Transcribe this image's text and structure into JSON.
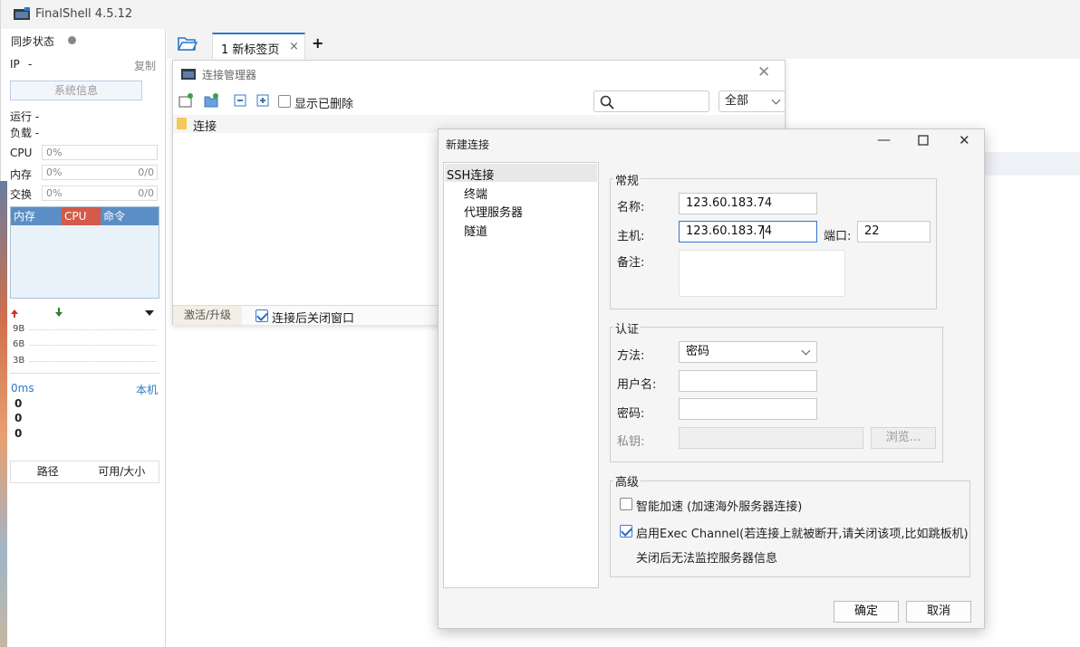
{
  "app": {
    "title": "FinalShell 4.5.12"
  },
  "left_panel": {
    "sync_label": "同步状态",
    "ip_label": "IP",
    "ip_value": "-",
    "copy_label": "复制",
    "sysinfo_button": "系统信息",
    "run_label": "运行 -",
    "load_label": "负载 -",
    "cpu": {
      "label": "CPU",
      "value": "0%"
    },
    "mem": {
      "label": "内存",
      "value": "0%",
      "detail": "0/0"
    },
    "swap": {
      "label": "交换",
      "value": "0%",
      "detail": "0/0"
    },
    "proc_cols": [
      "内存",
      "CPU",
      "命令"
    ],
    "net_labels": [
      "9B",
      "6B",
      "3B"
    ],
    "ping_label": "0ms",
    "ping_target": "本机",
    "ping_values": [
      "0",
      "0",
      "0"
    ],
    "disk_cols": [
      "路径",
      "可用/大小"
    ],
    "colors": {
      "proc_header": "#5b8ec4",
      "cpu_header": "#d45a4a",
      "up_arrow": "#c0392b",
      "down_arrow": "#2e7d32"
    }
  },
  "tabs": {
    "active": {
      "number": "1",
      "label": "新标签页"
    },
    "close_glyph": "×",
    "add_glyph": "+"
  },
  "conn_manager": {
    "title": "连接管理器",
    "show_deleted_label": "显示已删除",
    "filter_value": "全部",
    "tree_root": "连接",
    "activate_label": "激活/升级",
    "close_after_connect_label": "连接后关闭窗口"
  },
  "dialog": {
    "title": "新建连接",
    "nav": [
      "SSH连接",
      "终端",
      "代理服务器",
      "隧道"
    ],
    "general": {
      "legend": "常规",
      "name_label": "名称:",
      "name_value": "123.60.183.74",
      "host_label": "主机:",
      "host_value": "123.60.183.74",
      "port_label": "端口:",
      "port_value": "22",
      "note_label": "备注:"
    },
    "auth": {
      "legend": "认证",
      "method_label": "方法:",
      "method_value": "密码",
      "user_label": "用户名:",
      "password_label": "密码:",
      "key_label": "私钥:",
      "browse_button": "浏览..."
    },
    "advanced": {
      "legend": "高级",
      "accel_label": "智能加速 (加速海外服务器连接)",
      "exec_label": "启用Exec Channel(若连接上就被断开,请关闭该项,比如跳板机)",
      "exec_note": "关闭后无法监控服务器信息"
    },
    "ok_button": "确定",
    "cancel_button": "取消"
  }
}
